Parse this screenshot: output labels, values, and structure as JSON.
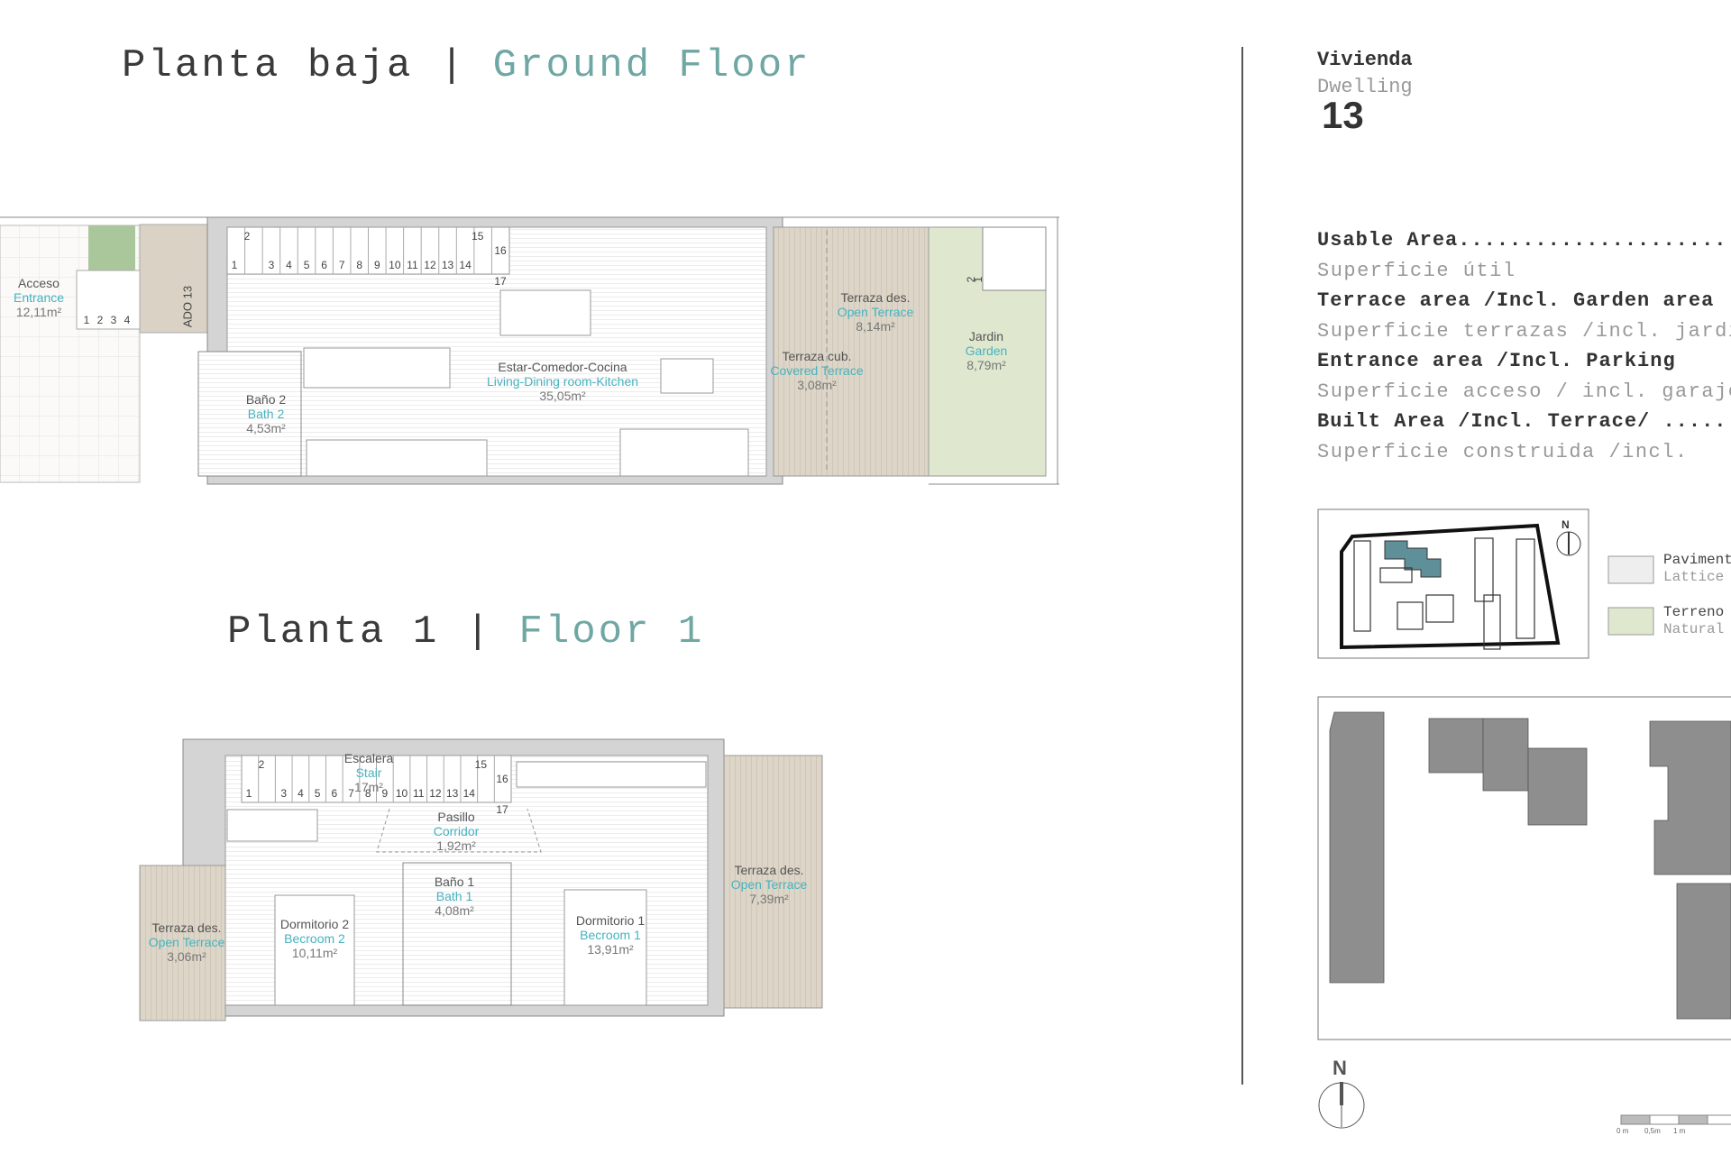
{
  "ground_floor": {
    "title_es": "Planta baja |",
    "title_en": "Ground Floor",
    "rooms": [
      {
        "es": "Acceso",
        "en": "Entrance",
        "area": "12,11m²"
      },
      {
        "es": "Baño 2",
        "en": "Bath 2",
        "area": "4,53m²"
      },
      {
        "es": "Estar-Comedor-Cocina",
        "en": "Living-Dining room-Kitchen",
        "area": "35,05m²"
      },
      {
        "es": "Terraza des.",
        "en": "Open Terrace",
        "area": "8,14m²"
      },
      {
        "es": "Terraza cub.",
        "en": "Covered Terrace",
        "area": "3,08m²"
      },
      {
        "es": "Jardin",
        "en": "Garden",
        "area": "8,79m²"
      }
    ],
    "door_label": "ADO 13",
    "stair_steps": [
      "1",
      "2",
      "3",
      "4",
      "5",
      "6",
      "7",
      "8",
      "9",
      "10",
      "11",
      "12",
      "13",
      "14",
      "15",
      "16",
      "17"
    ],
    "entry_steps": [
      "1",
      "2",
      "3",
      "4"
    ],
    "garden_steps": [
      "1",
      "2"
    ]
  },
  "floor_1": {
    "title_es": "Planta 1 |",
    "title_en": "Floor 1",
    "rooms": [
      {
        "es": "Escalera",
        "en": "Stair",
        "area": "17m²"
      },
      {
        "es": "Pasillo",
        "en": "Corridor",
        "area": "1,92m²"
      },
      {
        "es": "Baño 1",
        "en": "Bath 1",
        "area": "4,08m²"
      },
      {
        "es": "Dormitorio 2",
        "en": "Becroom 2",
        "area": "10,11m²"
      },
      {
        "es": "Dormitorio 1",
        "en": "Becroom 1",
        "area": "13,91m²"
      },
      {
        "es": "Terraza des.",
        "en": "Open Terrace",
        "area": "3,06m²"
      },
      {
        "es": "Terraza des.",
        "en": "Open Terrace",
        "area": "7,39m²"
      }
    ],
    "stair_steps": [
      "1",
      "2",
      "3",
      "4",
      "5",
      "6",
      "7",
      "8",
      "9",
      "10",
      "11",
      "12",
      "13",
      "14",
      "15",
      "16",
      "17"
    ]
  },
  "dwelling": {
    "label_es": "Vivienda",
    "label_en": "Dwelling",
    "number": "13"
  },
  "areas": [
    {
      "en": "Usable Area.....................",
      "es": "Superficie útil"
    },
    {
      "en": "Terrace area /Incl. Garden area",
      "es": "Superficie terrazas /incl. jardín"
    },
    {
      "en": "Entrance area /Incl. Parking",
      "es": "Superficie acceso / incl. garaje"
    },
    {
      "en": "Built Area /Incl. Terrace/ .....",
      "es": "Superficie construida /incl."
    }
  ],
  "legend": [
    {
      "a": "Pavimento",
      "b": "Lattice",
      "color": "#e8e8e8"
    },
    {
      "a": "Terreno",
      "b": "Natural",
      "color": "#dfe8cf"
    }
  ],
  "compass": "N",
  "scale_labels": [
    "0 m",
    "0,5m",
    "1 m"
  ],
  "colors": {
    "accent": "#45b3c0",
    "title_accent": "#6fa7a3",
    "terrace": "#ddd6c8",
    "garden": "#dfe8cf",
    "highlight": "#5f8f98",
    "building": "#8e8e8e"
  }
}
